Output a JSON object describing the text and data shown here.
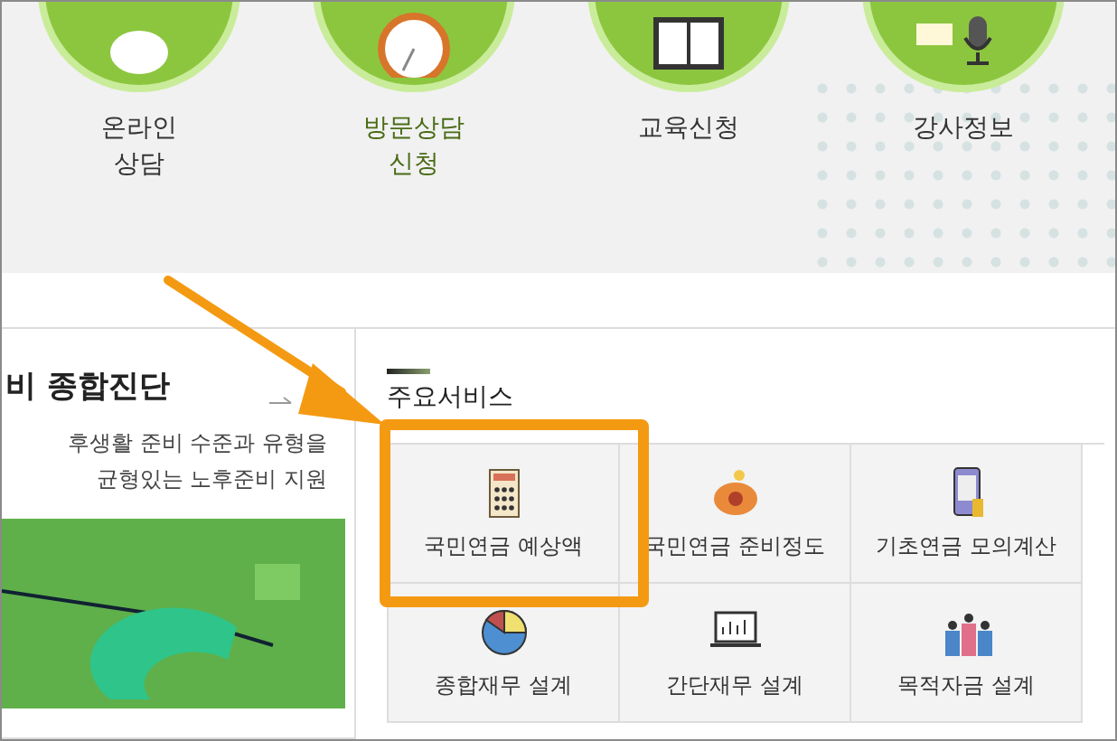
{
  "shortcuts": [
    {
      "label": "온라인\n상담",
      "kind": "chat",
      "selected": false
    },
    {
      "label": "방문상담\n신청",
      "kind": "clock",
      "selected": true
    },
    {
      "label": "교육신청",
      "kind": "board",
      "selected": false
    },
    {
      "label": "강사정보",
      "kind": "mic",
      "selected": false
    }
  ],
  "diagnosis": {
    "title": "비 종합진단",
    "lines": [
      "후생활 준비 수준과 유형을",
      "균형있는 노후준비 지원"
    ]
  },
  "services": {
    "heading": "주요서비스",
    "items": [
      {
        "label": "국민연금 예상액",
        "kind": "calculator",
        "highlighted": true
      },
      {
        "label": "국민연금 준비정도",
        "kind": "piggy",
        "highlighted": false
      },
      {
        "label": "기초연금 모의계산",
        "kind": "phone",
        "highlighted": false
      },
      {
        "label": "종합재무 설계",
        "kind": "pie",
        "highlighted": false
      },
      {
        "label": "간단재무 설계",
        "kind": "laptop",
        "highlighted": false
      },
      {
        "label": "목적자금 설계",
        "kind": "people",
        "highlighted": false
      }
    ]
  }
}
